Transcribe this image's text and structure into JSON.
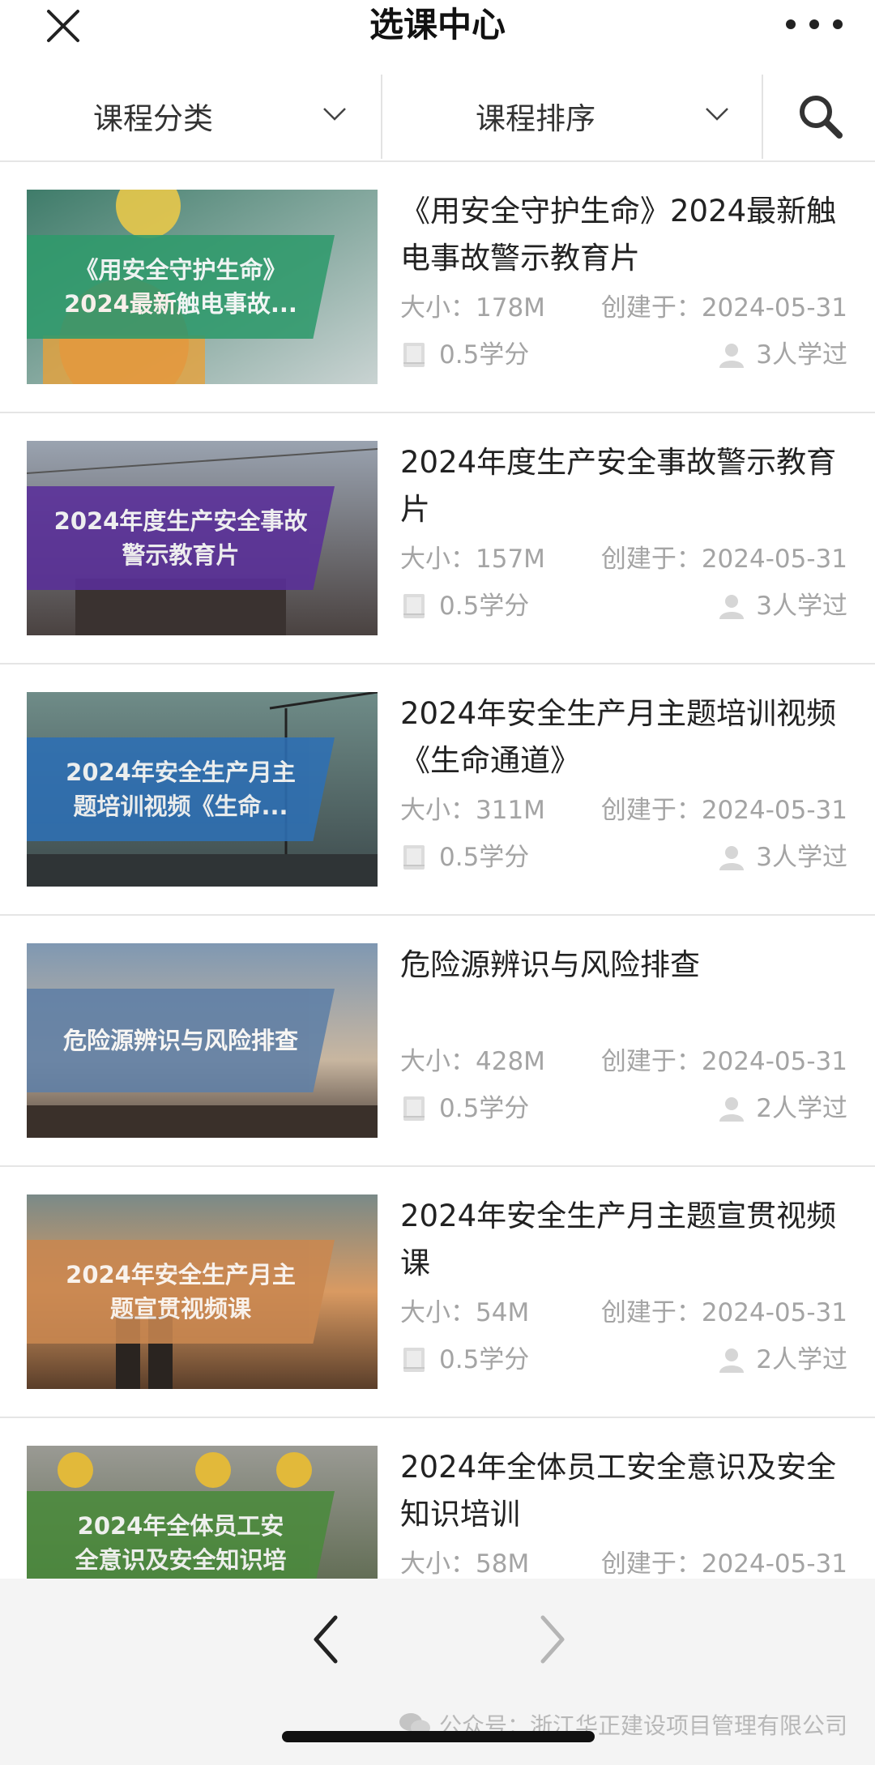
{
  "header": {
    "title": "选课中心",
    "close_icon": "close-icon",
    "more_icon": "more-icon"
  },
  "filters": {
    "category_label": "课程分类",
    "sort_label": "课程排序",
    "search_icon": "search-icon"
  },
  "colors": {
    "accent_text": "#222222",
    "meta_text": "#a4a4a4",
    "divider": "#e5e5e5",
    "bottom_bar": "#f4f4f4"
  },
  "courses": [
    {
      "title": "《用安全守护生命》2024最新触电事故警示教育片",
      "thumb_lines": [
        "《用安全守护生命》",
        "2024最新触电事故..."
      ],
      "banner_color": "#2f9a6c",
      "size": "大小：178M",
      "created": "创建于：2024-05-31",
      "credits": "0.5学分",
      "learners": "3人学过"
    },
    {
      "title": "2024年度生产安全事故警示教育片",
      "thumb_lines": [
        "2024年度生产安全事故",
        "警示教育片"
      ],
      "banner_color": "#5a2f9a",
      "size": "大小：157M",
      "created": "创建于：2024-05-31",
      "credits": "0.5学分",
      "learners": "3人学过"
    },
    {
      "title": "2024年安全生产月主题培训视频《生命通道》",
      "thumb_lines": [
        "2024年安全生产月主",
        "题培训视频《生命..."
      ],
      "banner_color": "#2d6fb4",
      "size": "大小：311M",
      "created": "创建于：2024-05-31",
      "credits": "0.5学分",
      "learners": "3人学过"
    },
    {
      "title": "危险源辨识与风险排查",
      "thumb_lines": [
        "危险源辨识与风险排查"
      ],
      "banner_color": "#5f7fa6",
      "size": "大小：428M",
      "created": "创建于：2024-05-31",
      "credits": "0.5学分",
      "learners": "2人学过"
    },
    {
      "title": "2024年安全生产月主题宣贯视频课",
      "thumb_lines": [
        "2024年安全生产月主",
        "题宣贯视频课"
      ],
      "banner_color": "#c98750",
      "size": "大小：54M",
      "created": "创建于：2024-05-31",
      "credits": "0.5学分",
      "learners": "2人学过"
    },
    {
      "title": "2024年全体员工安全意识及安全知识培训",
      "thumb_lines": [
        "2024年全体员工安",
        "全意识及安全知识培"
      ],
      "banner_color": "#4a8a3c",
      "size": "大小：58M",
      "created": "创建于：2024-05-31",
      "credits": "",
      "learners": ""
    }
  ],
  "footer": {
    "back_icon": "chevron-left-icon",
    "forward_icon": "chevron-right-icon",
    "watermark": "公众号：浙江华正建设项目管理有限公司"
  }
}
